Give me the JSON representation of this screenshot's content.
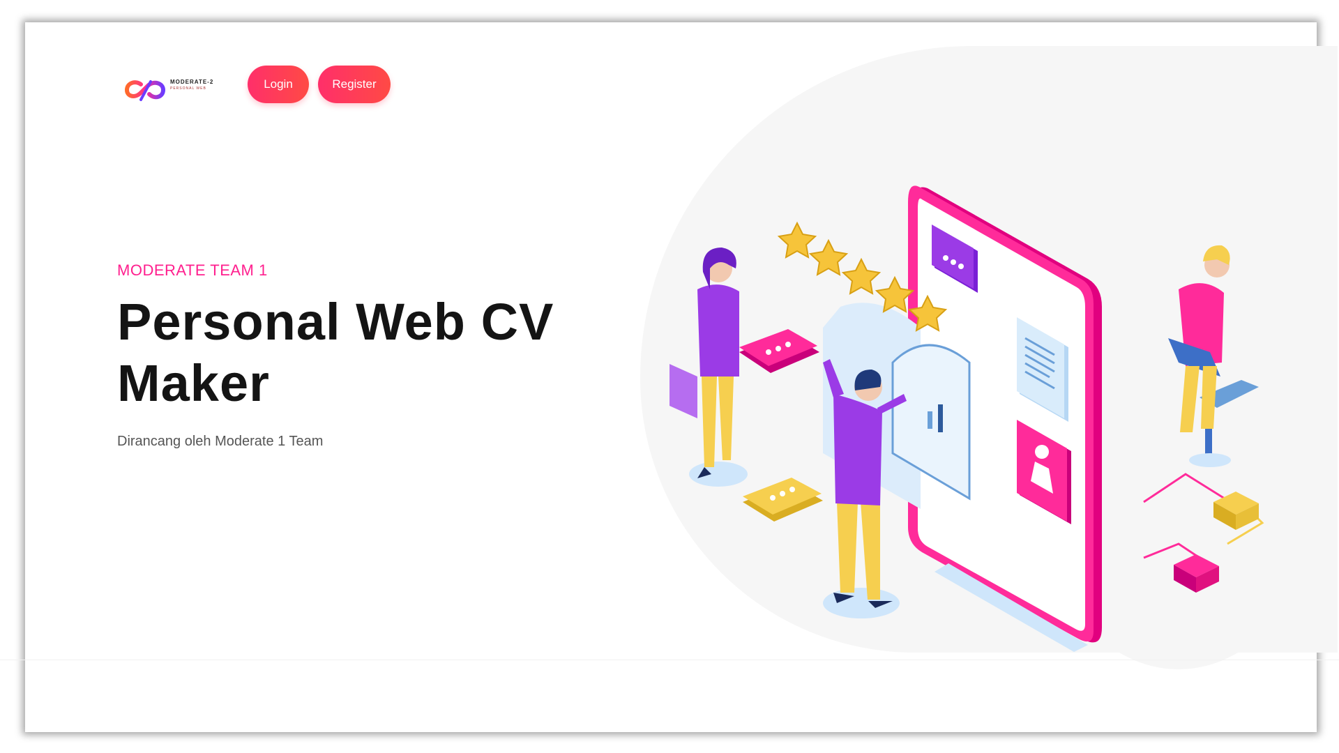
{
  "header": {
    "logo_text": "MODERATE-2",
    "logo_sub": "PERSONAL WEB",
    "login_label": "Login",
    "register_label": "Register"
  },
  "hero": {
    "eyebrow": "MODERATE TEAM 1",
    "title": "Personal Web CV Maker",
    "subtitle": "Dirancang oleh Moderate 1 Team"
  },
  "illustration": {
    "rating_stars": 5
  },
  "colors": {
    "accent": "#ff1f8e",
    "button_gradient_start": "#ff2f6a",
    "button_gradient_end": "#ff4a45",
    "purple": "#9b3be6",
    "yellow": "#f6cf4f",
    "light_blue": "#cfe6fb"
  }
}
